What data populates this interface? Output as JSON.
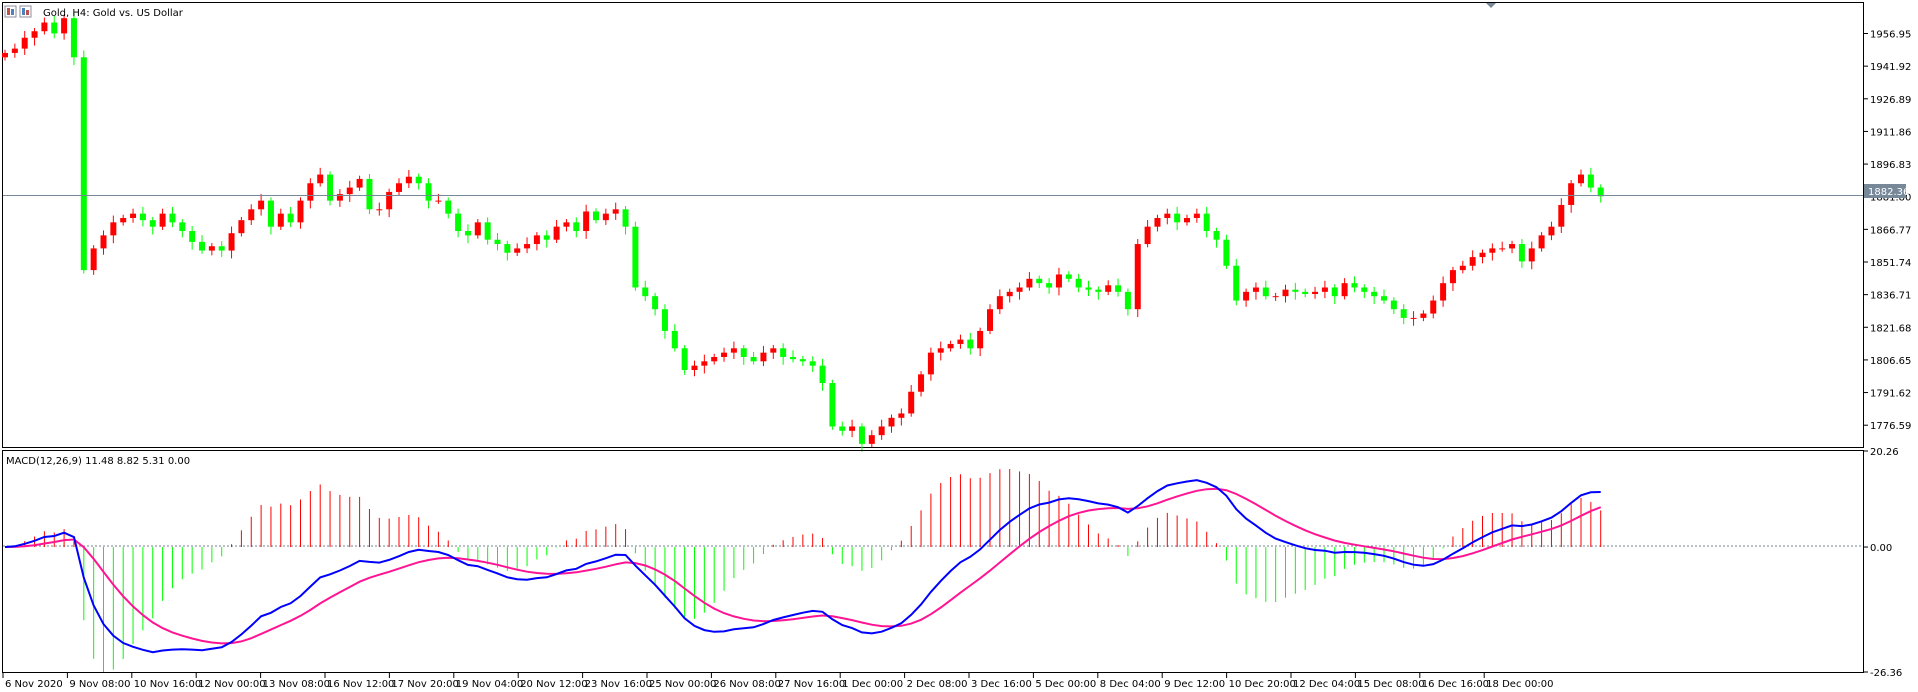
{
  "window": {
    "symbol_title": "Gold, H4:  Gold vs. US Dollar",
    "current_price_label": "1882.36"
  },
  "chart_data": [
    {
      "type": "candlestick",
      "symbol": "Gold",
      "timeframe": "H4",
      "description": "Gold vs. US Dollar",
      "ylim": [
        1766.55,
        1971.0
      ],
      "y_ticks": [
        "1956.95",
        "1941.92",
        "1926.89",
        "1911.86",
        "1896.83",
        "1881.80",
        "1866.77",
        "1851.74",
        "1836.71",
        "1821.68",
        "1806.65",
        "1791.62",
        "1776.59"
      ],
      "current_price": 1882.36,
      "x_ticks": [
        "6 Nov 2020",
        "9 Nov 08:00",
        "10 Nov 16:00",
        "12 Nov 00:00",
        "13 Nov 08:00",
        "16 Nov 12:00",
        "17 Nov 20:00",
        "19 Nov 04:00",
        "20 Nov 12:00",
        "23 Nov 16:00",
        "25 Nov 00:00",
        "26 Nov 08:00",
        "27 Nov 16:00",
        "1 Dec 00:00",
        "2 Dec 08:00",
        "3 Dec 16:00",
        "5 Dec 00:00",
        "8 Dec 04:00",
        "9 Dec 12:00",
        "10 Dec 20:00",
        "12 Dec 04:00",
        "15 Dec 08:00",
        "16 Dec 16:00",
        "18 Dec 00:00"
      ],
      "up_color": "#ff0000",
      "down_color": "#00ff00",
      "close": [
        1948,
        1950,
        1955,
        1958,
        1962,
        1957,
        1964,
        1946,
        1848,
        1858,
        1864,
        1870,
        1872,
        1874,
        1871,
        1868,
        1874,
        1870,
        1866,
        1861,
        1857,
        1859,
        1857,
        1865,
        1871,
        1876,
        1880,
        1868,
        1874,
        1870,
        1880,
        1888,
        1892,
        1880,
        1883,
        1886,
        1890,
        1876,
        1876,
        1884,
        1888,
        1891,
        1888,
        1880,
        1880,
        1874,
        1866,
        1864,
        1870,
        1862,
        1860,
        1856,
        1858,
        1860,
        1864,
        1862,
        1868,
        1870,
        1866,
        1875,
        1871,
        1874,
        1876,
        1868,
        1840,
        1836,
        1830,
        1820,
        1812,
        1802,
        1804,
        1806,
        1808,
        1810,
        1812,
        1808,
        1806,
        1810,
        1812,
        1808,
        1807,
        1806,
        1804,
        1796,
        1776,
        1774,
        1776,
        1768,
        1772,
        1776,
        1780,
        1782,
        1792,
        1800,
        1810,
        1812,
        1814,
        1816,
        1812,
        1820,
        1830,
        1836,
        1838,
        1840,
        1844,
        1842,
        1840,
        1846,
        1844,
        1840,
        1839,
        1838,
        1841,
        1838,
        1830,
        1860,
        1868,
        1872,
        1874,
        1870,
        1872,
        1874,
        1866,
        1862,
        1850,
        1834,
        1838,
        1840,
        1836,
        1836,
        1839,
        1838,
        1837,
        1838,
        1840,
        1836,
        1842,
        1840,
        1838,
        1836,
        1834,
        1830,
        1826,
        1826,
        1828,
        1834,
        1842,
        1848,
        1850,
        1854,
        1856,
        1858,
        1858,
        1860,
        1852,
        1858,
        1864,
        1868,
        1878,
        1888,
        1892,
        1886,
        1882
      ]
    },
    {
      "type": "macd",
      "label": "MACD(12,26,9) 11.48 8.82 5.31 0.00",
      "ylim": [
        -26.36,
        20.26
      ],
      "y_ticks": [
        "20.26",
        "0.00",
        "-26.36"
      ],
      "series": [
        {
          "name": "MACD",
          "color": "#0000ff"
        },
        {
          "name": "Signal",
          "color": "#ff1493"
        },
        {
          "name": "OsMA",
          "up_color": "#ff0000",
          "down_color": "#00ff00"
        }
      ]
    }
  ]
}
